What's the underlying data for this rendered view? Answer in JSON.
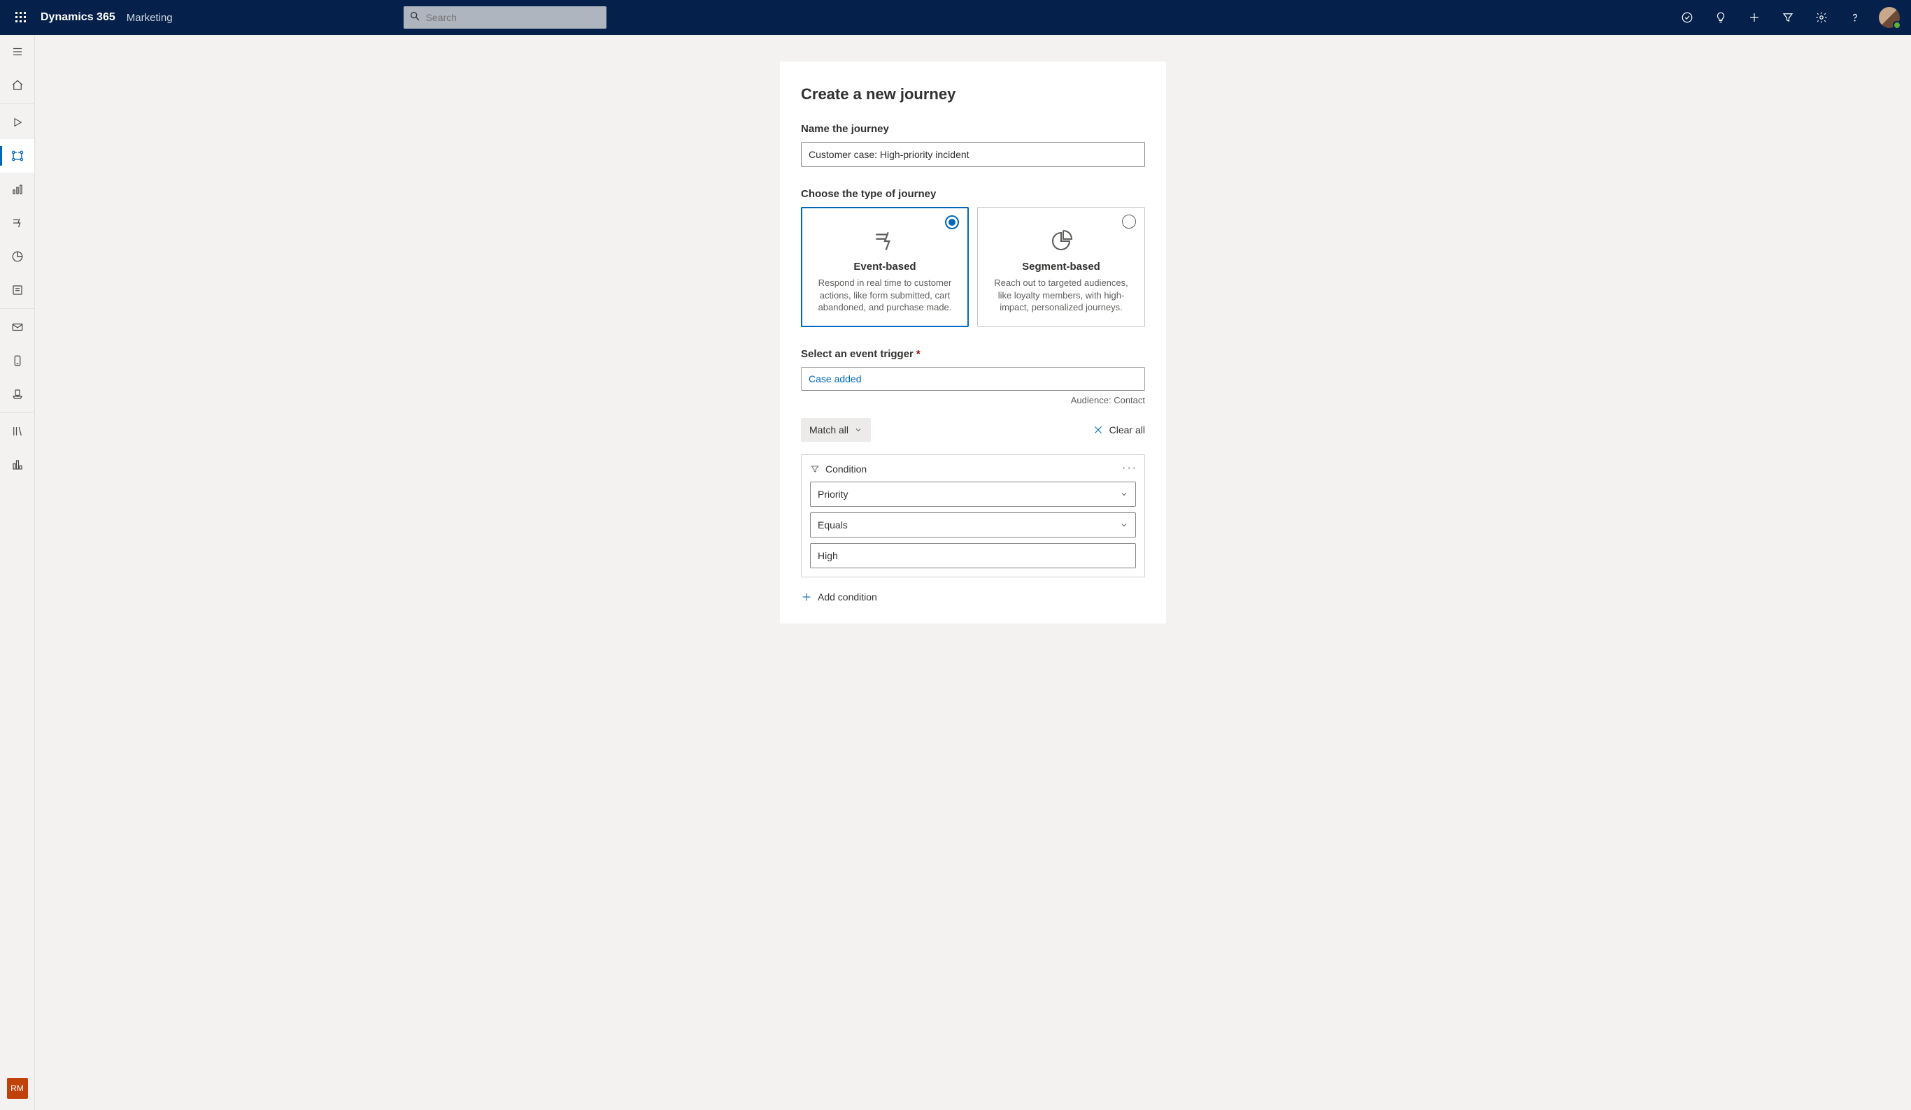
{
  "topbar": {
    "brand": "Dynamics 365",
    "module": "Marketing",
    "search_placeholder": "Search"
  },
  "sidebar": {
    "rm_badge": "RM"
  },
  "panel": {
    "title": "Create a new journey",
    "name_label": "Name the journey",
    "name_value": "Customer case: High-priority incident",
    "type_label": "Choose the type of journey",
    "types": {
      "event": {
        "title": "Event-based",
        "desc": "Respond in real time to customer actions, like form submitted, cart abandoned, and purchase made."
      },
      "segment": {
        "title": "Segment-based",
        "desc": "Reach out to targeted audiences, like loyalty members, with high-impact, personalized journeys."
      }
    },
    "trigger_label": "Select an event trigger",
    "trigger_value": "Case added",
    "audience_note": "Audience: Contact",
    "match_label": "Match all",
    "clear_label": "Clear all",
    "condition_label": "Condition",
    "condition_field": "Priority",
    "condition_op": "Equals",
    "condition_value": "High",
    "add_condition": "Add condition"
  }
}
